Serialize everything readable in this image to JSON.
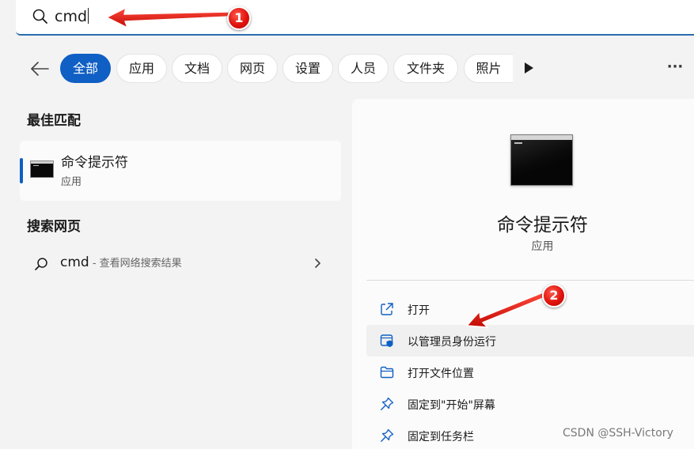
{
  "search": {
    "query": "cmd"
  },
  "filters": {
    "back_icon": "back-arrow-icon",
    "tabs": [
      {
        "label": "全部",
        "active": true
      },
      {
        "label": "应用"
      },
      {
        "label": "文档"
      },
      {
        "label": "网页"
      },
      {
        "label": "设置"
      },
      {
        "label": "人员"
      },
      {
        "label": "文件夹"
      },
      {
        "label": "照片"
      }
    ],
    "play_icon": "play-icon",
    "more_icon": "more-icon",
    "more_label": "···"
  },
  "best_match": {
    "section_title": "最佳匹配",
    "title": "命令提示符",
    "subtitle": "应用",
    "icon": "command-prompt-icon"
  },
  "web": {
    "section_title": "搜索网页",
    "query": "cmd",
    "description": " - 查看网络搜索结果",
    "icon": "search-icon"
  },
  "detail": {
    "title": "命令提示符",
    "subtitle": "应用",
    "actions": [
      {
        "label": "打开",
        "icon": "open-external-icon"
      },
      {
        "label": "以管理员身份运行",
        "icon": "shield-admin-icon"
      },
      {
        "label": "打开文件位置",
        "icon": "folder-icon"
      },
      {
        "label": "固定到\"开始\"屏幕",
        "icon": "pin-icon"
      },
      {
        "label": "固定到任务栏",
        "icon": "pin-icon"
      }
    ]
  },
  "annotations": {
    "badge_1": "1",
    "badge_2": "2",
    "color": "#e0130d"
  },
  "watermark": "CSDN @SSH-Victory",
  "colors": {
    "accent": "#0f5fc4",
    "background": "#f3f3f3",
    "panel": "#fbfbfb"
  }
}
